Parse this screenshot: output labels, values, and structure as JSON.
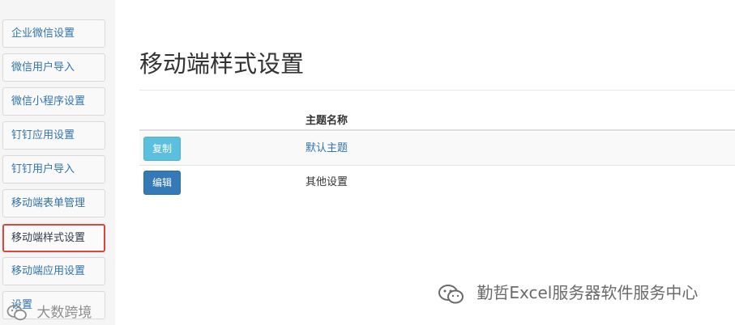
{
  "sidebar": {
    "items": [
      {
        "label": "企业微信设置",
        "active": false
      },
      {
        "label": "微信用户导入",
        "active": false
      },
      {
        "label": "微信小程序设置",
        "active": false
      },
      {
        "label": "钉钉应用设置",
        "active": false
      },
      {
        "label": "钉钉用户导入",
        "active": false
      },
      {
        "label": "移动端表单管理",
        "active": false
      },
      {
        "label": "移动端样式设置",
        "active": true
      },
      {
        "label": "移动端应用设置",
        "active": false
      },
      {
        "label": "设置",
        "active": false
      }
    ]
  },
  "main": {
    "title": "移动端样式设置",
    "table": {
      "column_header": "主题名称",
      "rows": [
        {
          "action_label": "复制",
          "name": "默认主题"
        },
        {
          "action_label": "编辑",
          "name": "其他设置"
        }
      ]
    }
  },
  "watermarks": {
    "primary": "勤哲Excel服务器软件服务中心",
    "secondary": "大数跨境"
  },
  "colors": {
    "link": "#3273ad",
    "copy_button": "#5bc0de",
    "edit_button": "#337ab7",
    "active_border": "#e0453b"
  }
}
